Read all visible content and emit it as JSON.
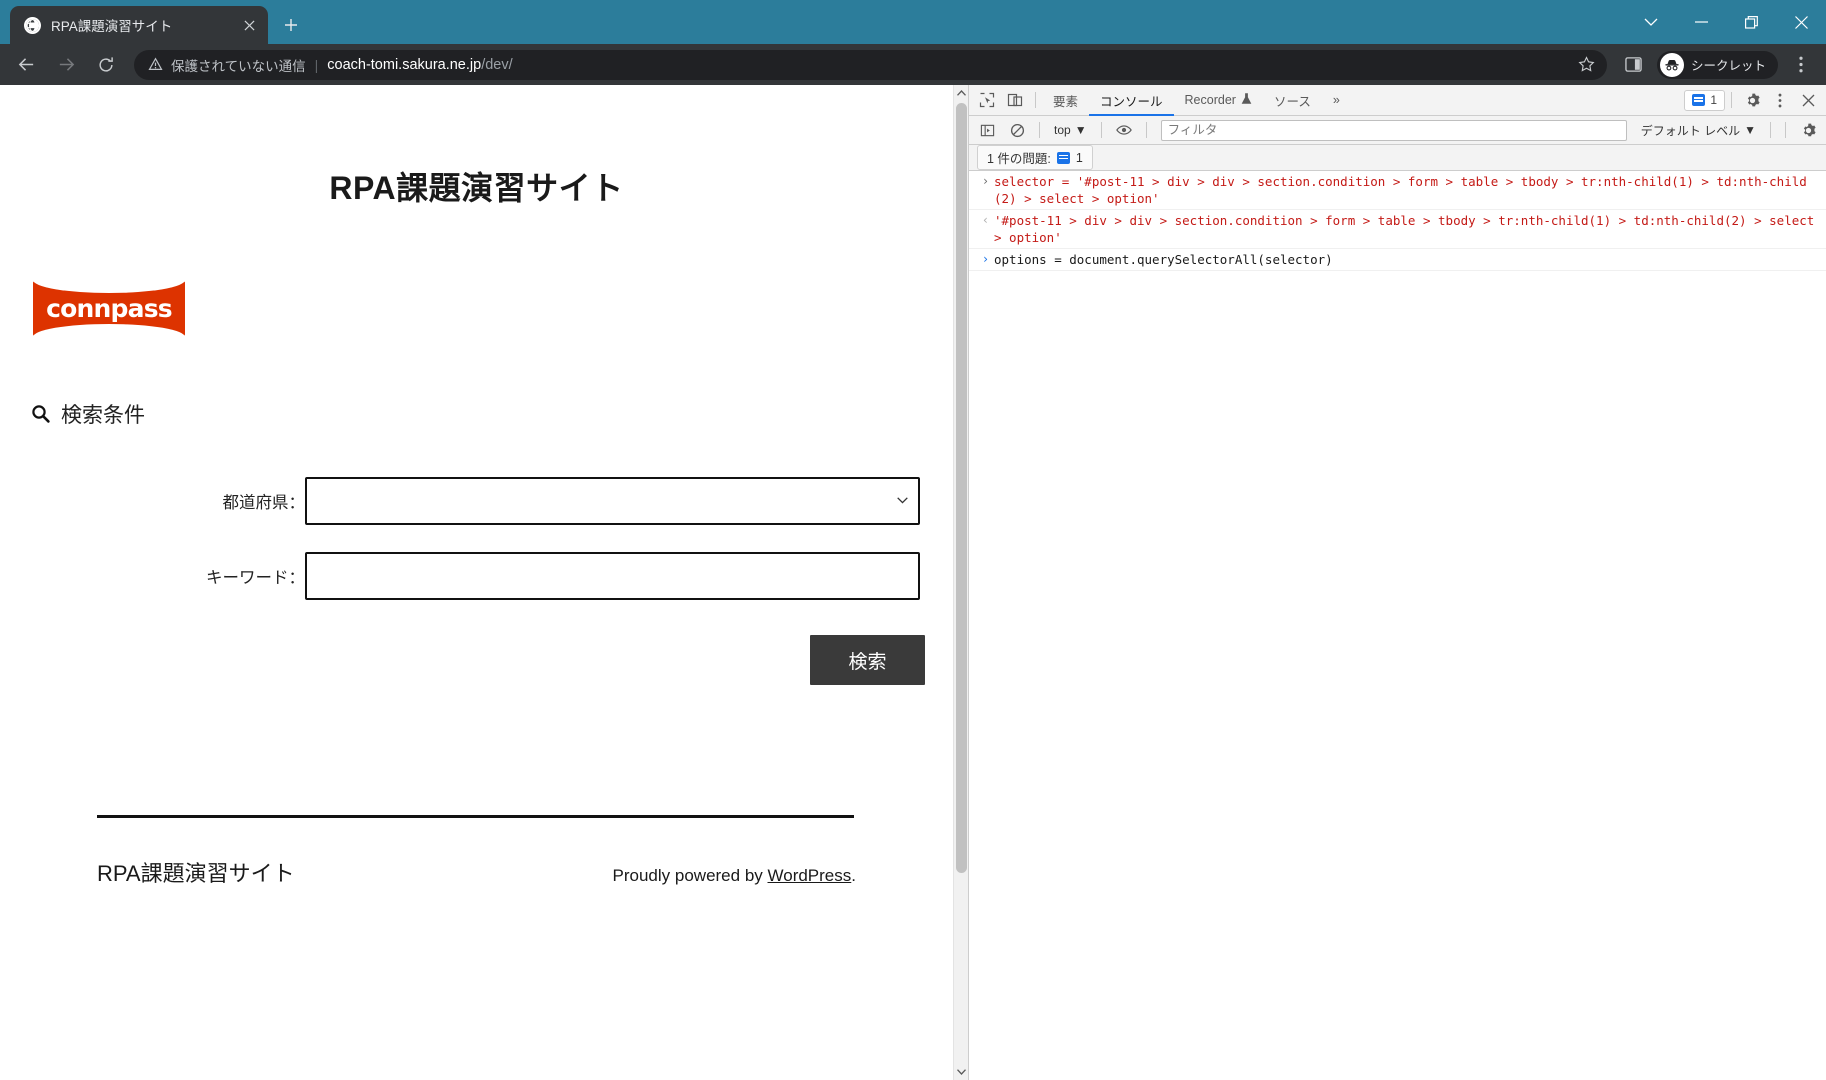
{
  "browser": {
    "tab": {
      "title": "RPA課題演習サイト",
      "favicon": "globe-icon",
      "close": "×"
    },
    "new_tab_label": "+",
    "window_controls": {
      "minimize": "−",
      "restore": "❐",
      "close": "✕",
      "chevron": "⌄"
    },
    "omnibox": {
      "security_text": "保護されていない通信",
      "separator": "|",
      "url_host": "coach-tomi.sakura.ne.jp",
      "url_path": "/dev/"
    },
    "incognito_label": "シークレット",
    "accent_titlebar": "#2c7d9b"
  },
  "page": {
    "site_title": "RPA課題演習サイト",
    "logo_text": "connpass",
    "logo_color": "#dd3300",
    "condition_heading": "検索条件",
    "form": {
      "pref_label": "都道府県：",
      "pref_value": "",
      "pref_options": [
        ""
      ],
      "keyword_label": "キーワード：",
      "keyword_value": "",
      "keyword_placeholder": "",
      "submit_label": "検索"
    },
    "footer": {
      "site_name": "RPA課題演習サイト",
      "credit_prefix": "Proudly powered by ",
      "credit_link": "WordPress",
      "credit_suffix": "."
    }
  },
  "devtools": {
    "tabs": [
      {
        "label": "要素",
        "active": false
      },
      {
        "label": "コンソール",
        "active": true
      },
      {
        "label": "Recorder",
        "active": false,
        "badge": "flask-icon"
      },
      {
        "label": "ソース",
        "active": false
      }
    ],
    "more_tabs": "»",
    "issue_chip_count": "1",
    "toolbar": {
      "context": "top",
      "context_caret": "▼",
      "filter_placeholder": "フィルタ",
      "filter_value": "",
      "levels": "デフォルト レベル",
      "levels_caret": "▼"
    },
    "issuebar": {
      "text": "1 件の問題:",
      "count": "1"
    },
    "console_lines": [
      {
        "gutter": "›",
        "type": "input",
        "text": "selector = '#post-11 > div > div > section.condition > form > table > tbody > tr:nth-child(1) > td:nth-child(2) > select > option'"
      },
      {
        "gutter": "‹",
        "type": "output",
        "text": "'#post-11 > div > div > section.condition > form > table > tbody > tr:nth-child(1) > td:nth-child(2) > select > option'"
      },
      {
        "gutter": "›",
        "type": "prompt",
        "text": "options = document.querySelectorAll(selector)"
      }
    ]
  }
}
